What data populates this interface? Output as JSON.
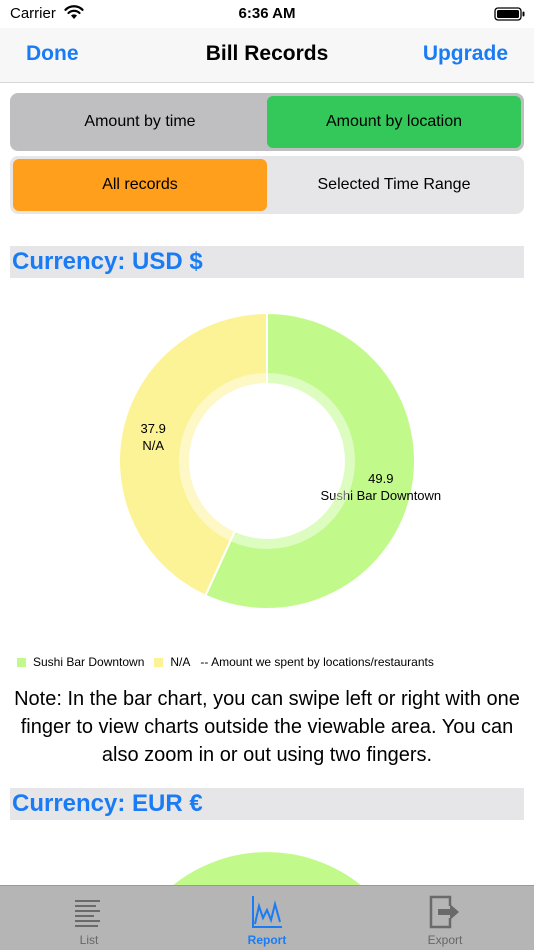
{
  "status": {
    "carrier": "Carrier",
    "time": "6:36 AM"
  },
  "nav": {
    "done": "Done",
    "title": "Bill Records",
    "upgrade": "Upgrade"
  },
  "segment_view": {
    "options": [
      "Amount by time",
      "Amount by location"
    ],
    "selected": "Amount by location",
    "selected_color": "#34c759"
  },
  "segment_range": {
    "options": [
      "All records",
      "Selected Time Range"
    ],
    "selected": "All records",
    "selected_color": "#ff9f1c"
  },
  "sections": [
    {
      "currency_label": "Currency: USD $"
    },
    {
      "currency_label": "Currency: EUR €"
    }
  ],
  "chart_data": {
    "type": "pie",
    "labels": [
      "Sushi Bar Downtown",
      "N/A"
    ],
    "values": [
      49.9,
      37.9
    ],
    "colors": [
      "#c2f98b",
      "#fcf397"
    ],
    "legend_position": "bottom-left",
    "legend_note": "-- Amount we spent by locations/restaurants"
  },
  "note": "Note: In the bar chart, you can swipe left or right with one finger to view charts outside the viewable area. You can also  zoom in or out using two fingers.",
  "tabs": [
    {
      "label": "List",
      "icon": "list-icon",
      "active": false
    },
    {
      "label": "Report",
      "icon": "report-chart-icon",
      "active": true
    },
    {
      "label": "Export",
      "icon": "export-icon",
      "active": false
    }
  ],
  "accent_color": "#1a7cf5"
}
